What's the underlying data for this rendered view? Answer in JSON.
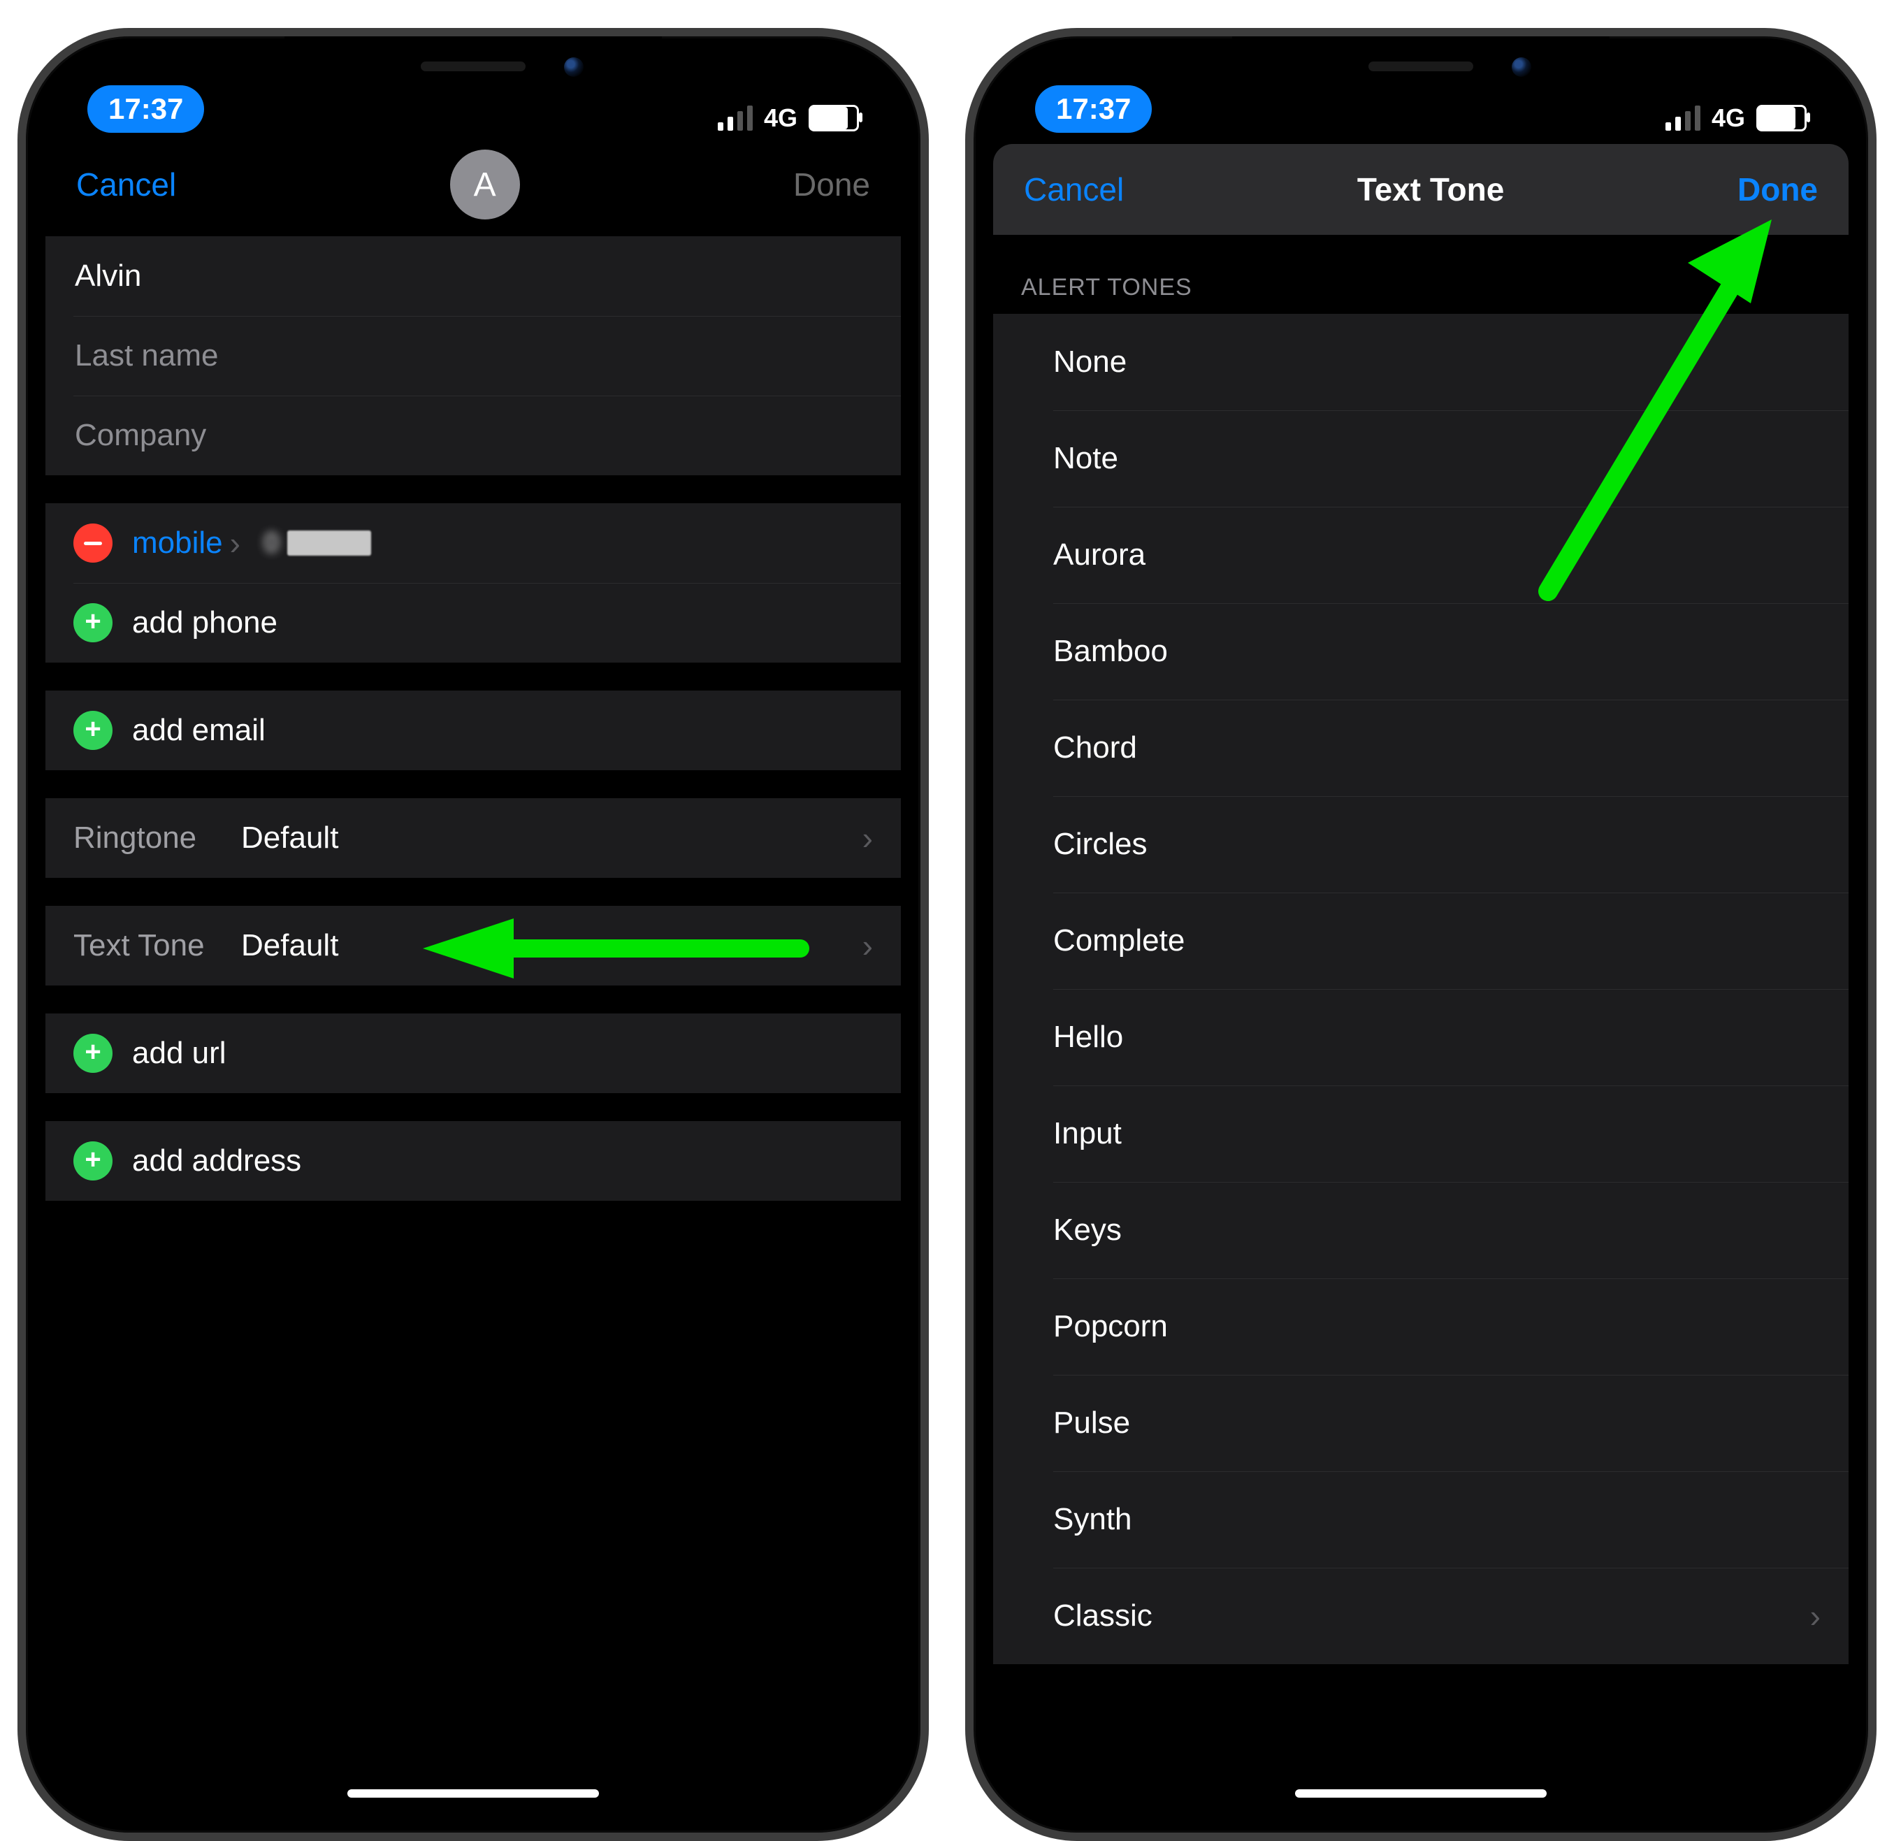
{
  "status": {
    "time": "17:37",
    "network": "4G"
  },
  "left": {
    "nav": {
      "cancel": "Cancel",
      "done": "Done",
      "avatar_initial": "A"
    },
    "name_fields": {
      "first_value": "Alvin",
      "last_placeholder": "Last name",
      "company_placeholder": "Company"
    },
    "phone": {
      "type_label": "mobile",
      "add_phone": "add phone"
    },
    "email": {
      "add_email": "add email"
    },
    "ringtone": {
      "label": "Ringtone",
      "value": "Default"
    },
    "texttone": {
      "label": "Text Tone",
      "value": "Default"
    },
    "url": {
      "add_url": "add url"
    },
    "address": {
      "add_address": "add address"
    }
  },
  "right": {
    "nav": {
      "cancel": "Cancel",
      "title": "Text Tone",
      "done": "Done"
    },
    "section_header": "ALERT TONES",
    "tones": [
      "None",
      "Note",
      "Aurora",
      "Bamboo",
      "Chord",
      "Circles",
      "Complete",
      "Hello",
      "Input",
      "Keys",
      "Popcorn",
      "Pulse",
      "Synth",
      "Classic"
    ]
  }
}
